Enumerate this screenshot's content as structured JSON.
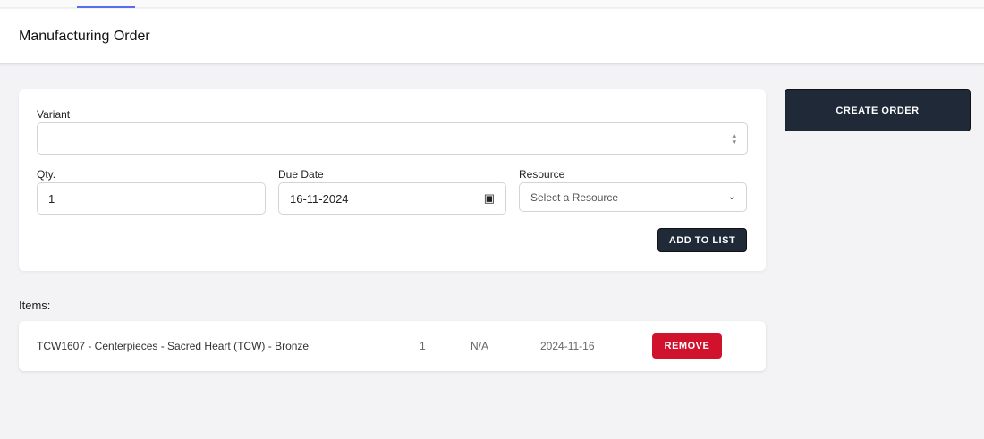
{
  "header": {
    "title": "Manufacturing Order"
  },
  "form": {
    "variant_label": "Variant",
    "variant_value": "",
    "qty_label": "Qty.",
    "qty_value": "1",
    "due_label": "Due Date",
    "due_value": "16-11-2024",
    "resource_label": "Resource",
    "resource_placeholder": "Select a Resource",
    "add_button": "ADD TO LIST"
  },
  "create_button": "CREATE ORDER",
  "items_label": "Items:",
  "items": [
    {
      "name": "TCW1607 - Centerpieces - Sacred Heart (TCW) - Bronze",
      "qty": "1",
      "resource": "N/A",
      "date": "2024-11-16",
      "remove": "REMOVE"
    }
  ]
}
